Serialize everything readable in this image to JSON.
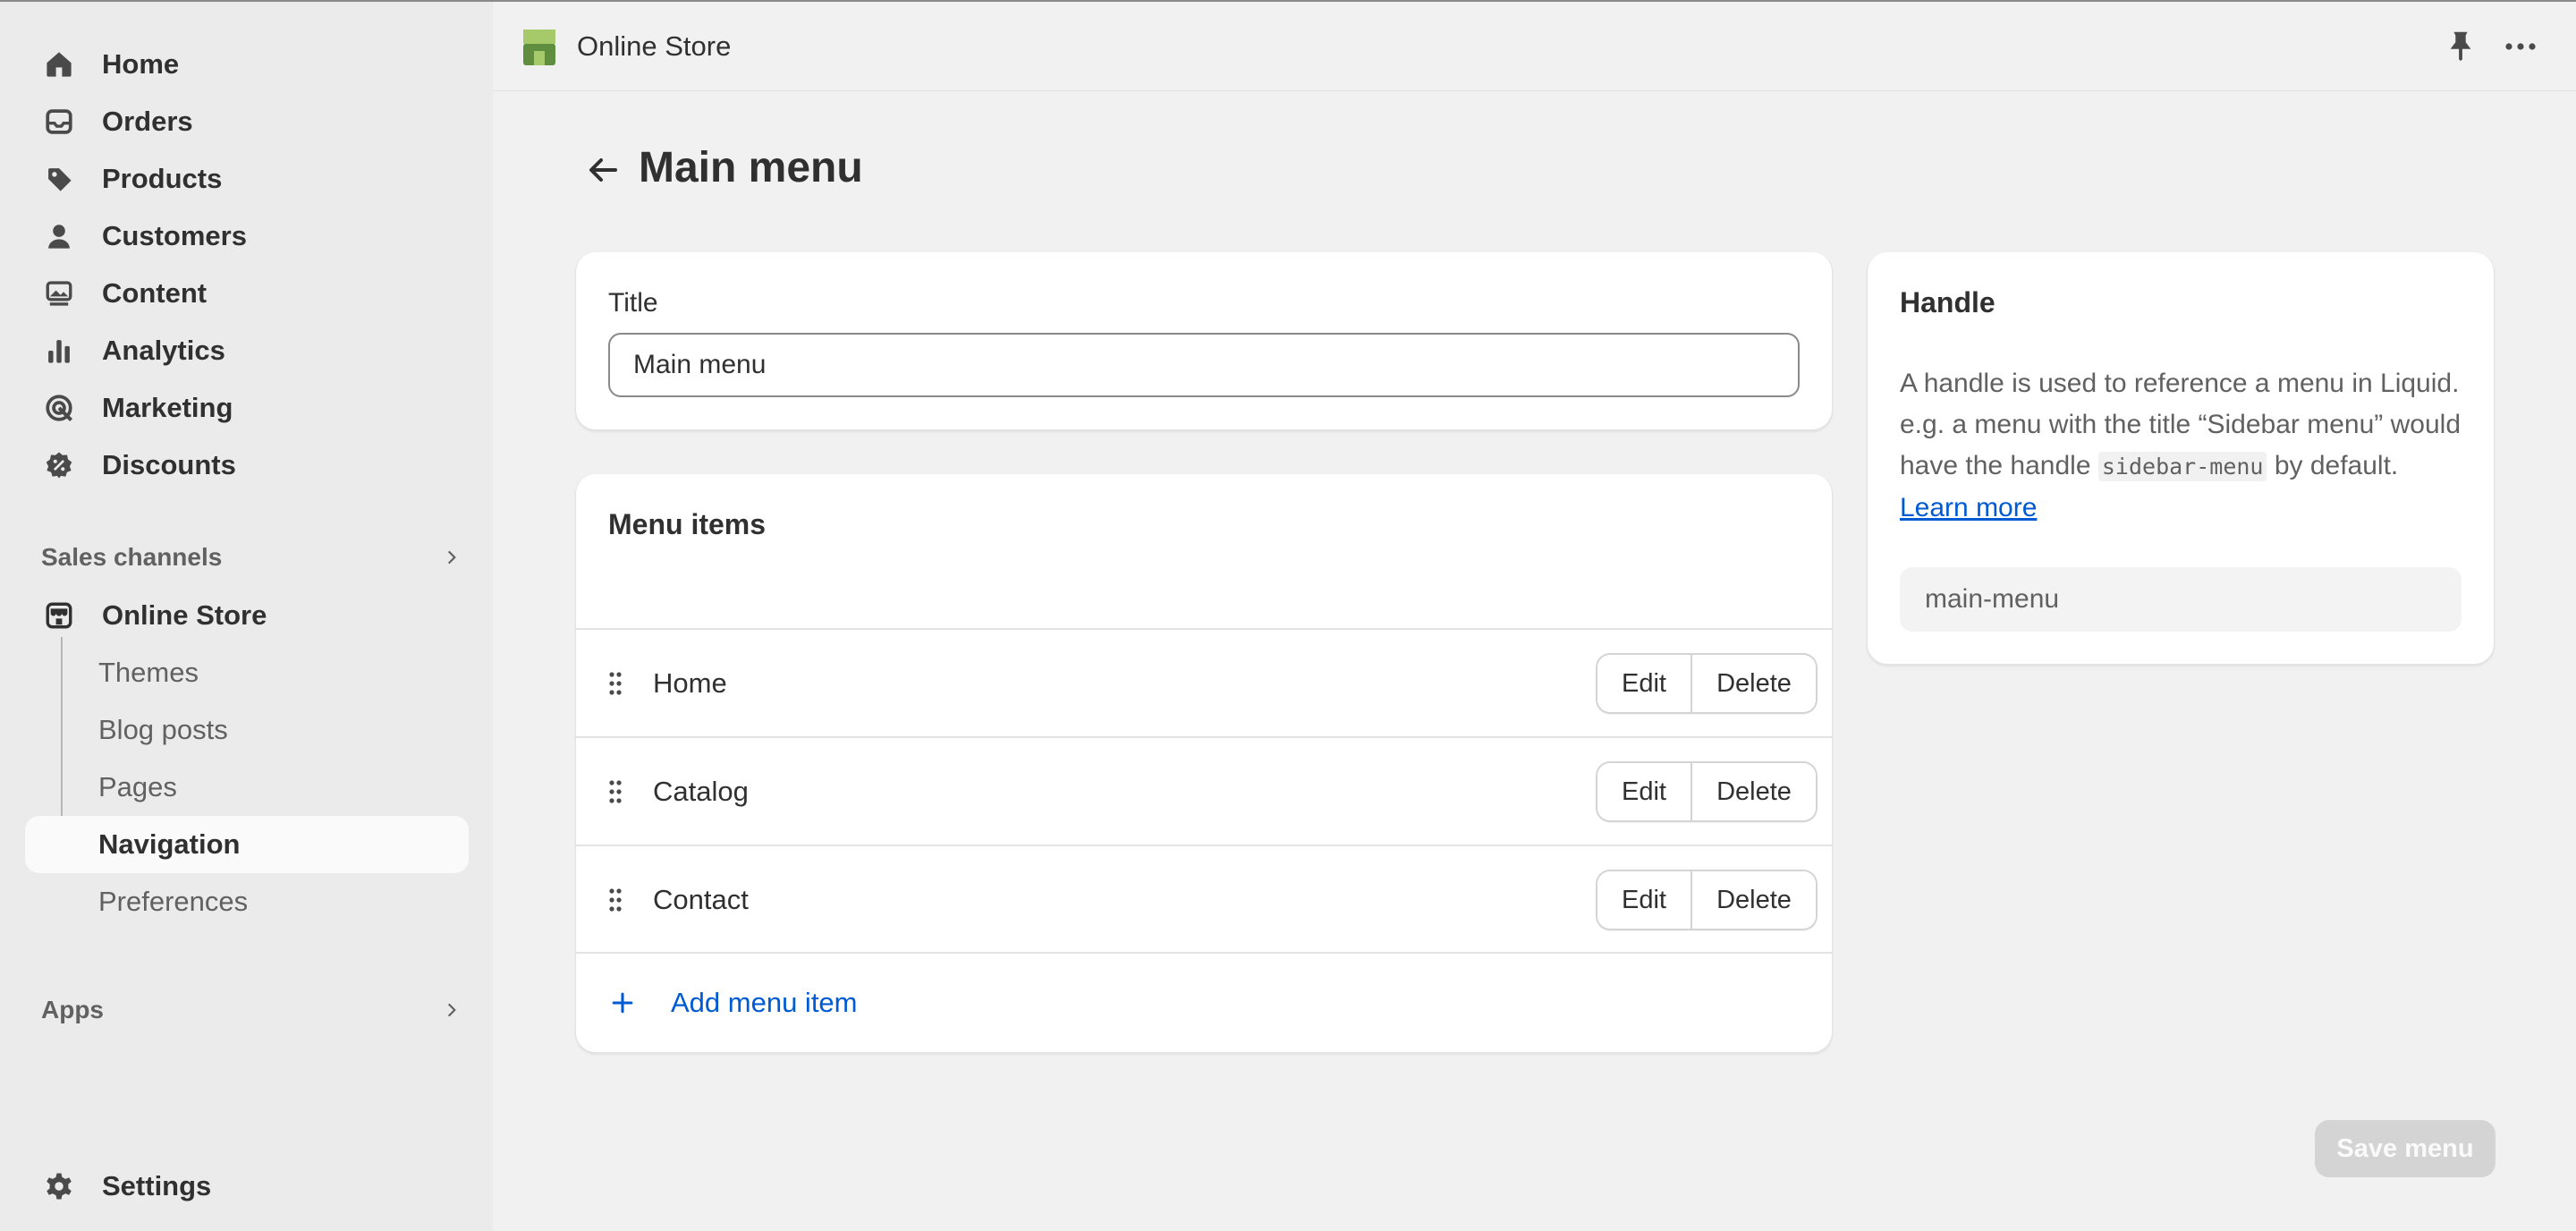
{
  "sidebar": {
    "nav": [
      {
        "label": "Home",
        "icon": "home-icon"
      },
      {
        "label": "Orders",
        "icon": "inbox-icon"
      },
      {
        "label": "Products",
        "icon": "tag-icon"
      },
      {
        "label": "Customers",
        "icon": "person-icon"
      },
      {
        "label": "Content",
        "icon": "image-icon"
      },
      {
        "label": "Analytics",
        "icon": "bar-chart-icon"
      },
      {
        "label": "Marketing",
        "icon": "target-icon"
      },
      {
        "label": "Discounts",
        "icon": "discount-icon"
      }
    ],
    "sales_channels_label": "Sales channels",
    "online_store_label": "Online Store",
    "online_store_sub": [
      "Themes",
      "Blog posts",
      "Pages",
      "Navigation",
      "Preferences"
    ],
    "active_sub": "Navigation",
    "apps_label": "Apps",
    "settings_label": "Settings"
  },
  "topbar": {
    "store_name": "Online Store",
    "brand_color": "#5e8e3e"
  },
  "page": {
    "title": "Main menu"
  },
  "title_card": {
    "label": "Title",
    "value": "Main menu"
  },
  "menu_card": {
    "heading": "Menu items",
    "items": [
      "Home",
      "Catalog",
      "Contact"
    ],
    "edit_label": "Edit",
    "delete_label": "Delete",
    "add_label": "Add menu item"
  },
  "handle_card": {
    "heading": "Handle",
    "desc_part1": "A handle is used to reference a menu in Liquid. e.g. a menu with the title “Sidebar menu” would have the handle ",
    "desc_code": "sidebar-menu",
    "desc_part2": " by default. ",
    "learn_more": "Learn more",
    "value": "main-menu"
  },
  "save_label": "Save menu",
  "colors": {
    "link": "#005bd3",
    "sidebar_bg": "#ebebeb",
    "page_bg": "#f1f1f1"
  }
}
